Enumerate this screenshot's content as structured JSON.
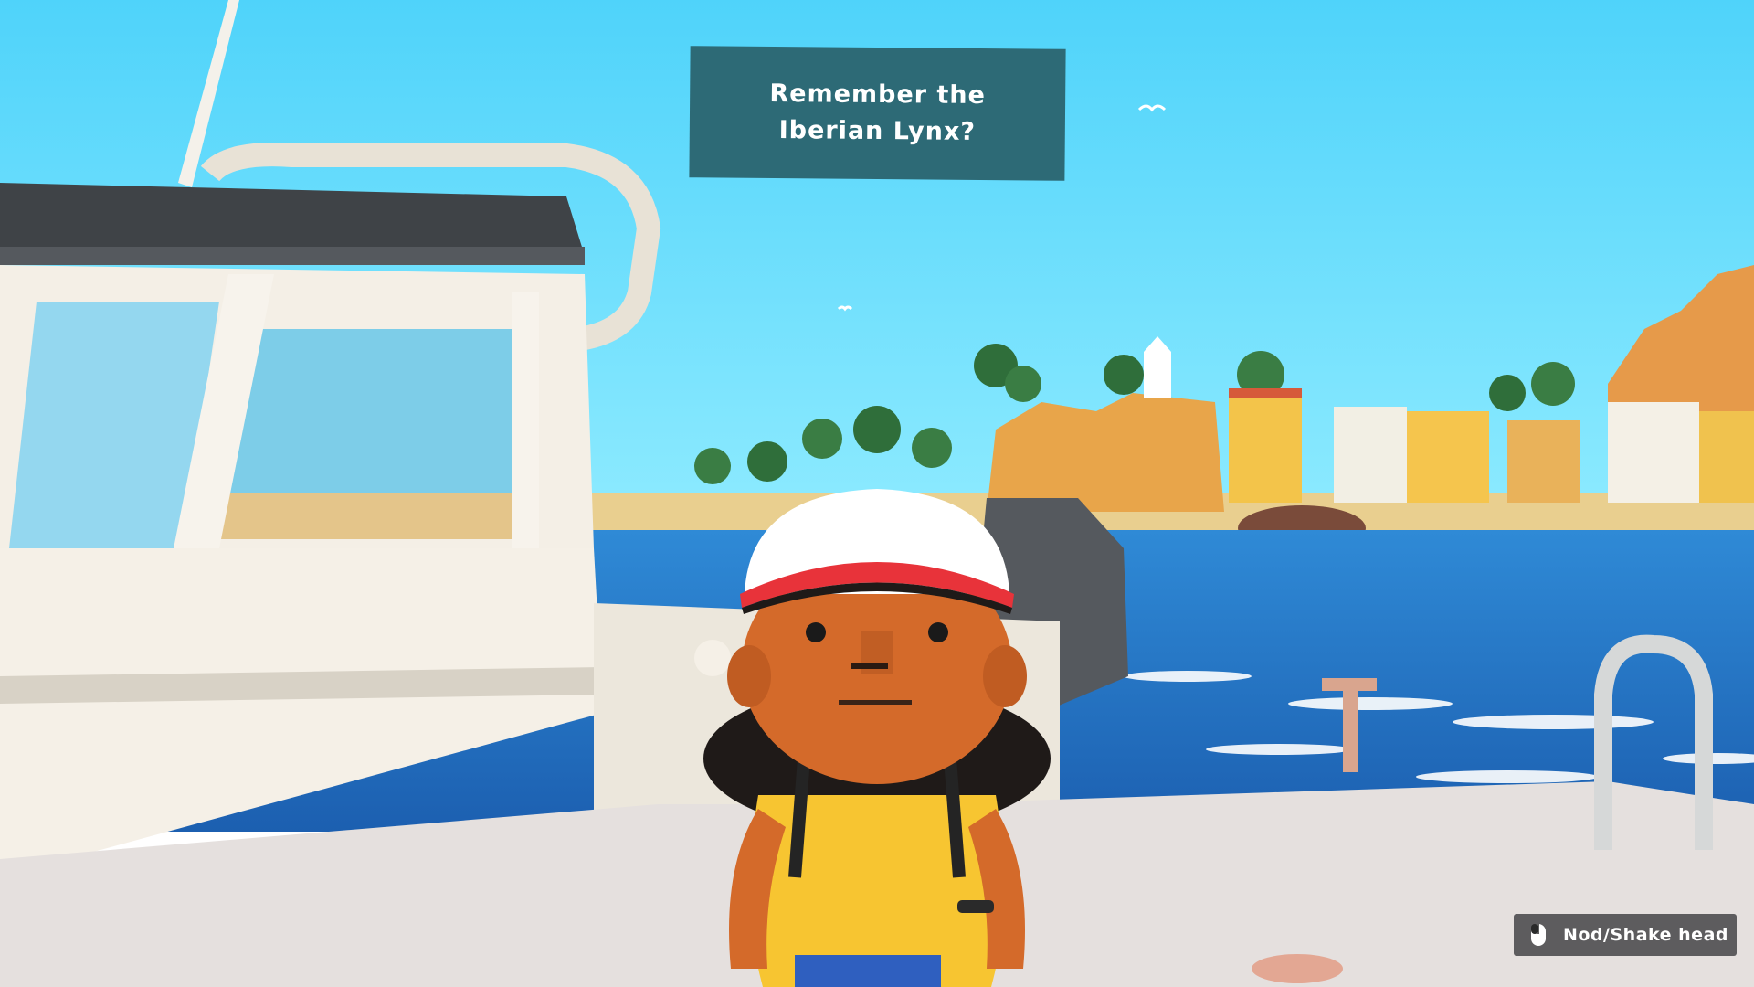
{
  "dialog": {
    "text": "Remember the Iberian Lynx?"
  },
  "hint": {
    "icon": "mouse-icon",
    "label": "Nod/Shake head"
  },
  "colors": {
    "sky": "#52d6f7",
    "sea": "#1f6fc0",
    "dialog_bg": "#2d6a76",
    "cap_red": "#e8333a",
    "shirt": "#f7c531",
    "skin": "#d46a2a"
  }
}
